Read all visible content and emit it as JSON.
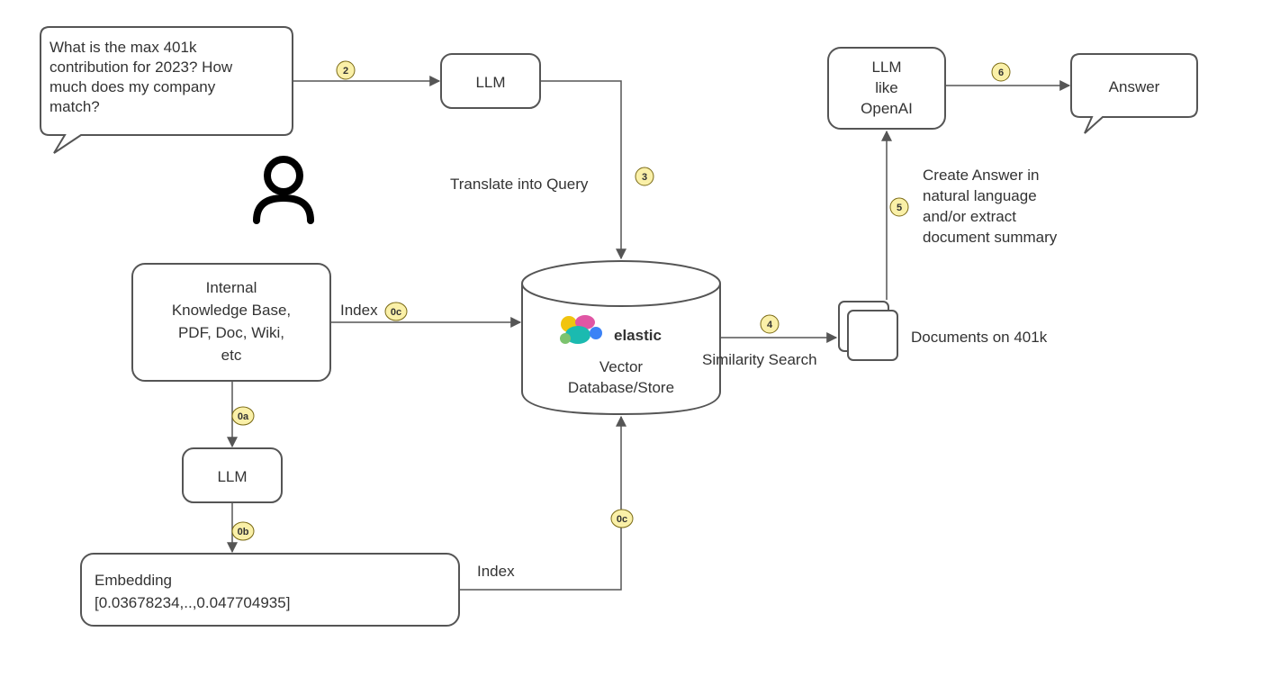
{
  "nodes": {
    "question": {
      "lines": [
        "What is the max 401k",
        "contribution for 2023? How",
        "much does my company",
        "match?"
      ]
    },
    "llm1": {
      "label": "LLM"
    },
    "kb": {
      "lines": [
        "Internal",
        "Knowledge Base,",
        "PDF, Doc, Wiki,",
        "etc"
      ]
    },
    "llm2": {
      "label": "LLM"
    },
    "embedding": {
      "lines": [
        "Embedding",
        "[0.03678234,..,0.047704935]"
      ]
    },
    "vectordb": {
      "brand": "elastic",
      "lines": [
        "Vector",
        "Database/Store"
      ]
    },
    "llm3": {
      "lines": [
        "LLM",
        "like",
        "OpenAI"
      ]
    },
    "docs": {
      "label": "Documents on 401k"
    },
    "answer": {
      "label": "Answer"
    }
  },
  "edges": {
    "translate": {
      "label": "Translate into Query"
    },
    "index1": {
      "label": "Index"
    },
    "index2": {
      "label": "Index"
    },
    "similarity": {
      "label": "Similarity Search"
    },
    "createAnswer": {
      "lines": [
        "Create Answer in",
        "natural language",
        "and/or extract",
        "document summary"
      ]
    }
  },
  "badges": {
    "b0a": "0a",
    "b0b": "0b",
    "b0c1": "0c",
    "b0c2": "0c",
    "b2": "2",
    "b3": "3",
    "b4": "4",
    "b5": "5",
    "b6": "6"
  }
}
